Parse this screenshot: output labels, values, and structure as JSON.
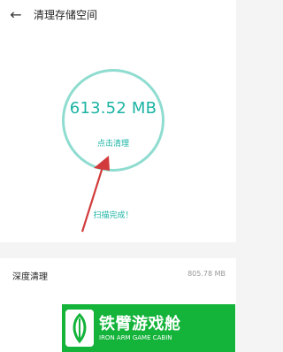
{
  "header": {
    "back_icon": "arrow-left-icon",
    "title": "清理存储空间"
  },
  "scan": {
    "size_text": "613.52 MB",
    "clean_link": "点击清理",
    "status": "扫描完成！",
    "ring_color": "#8fdcd0",
    "accent_color": "#19b3a3"
  },
  "deep_clean": {
    "label": "深度清理",
    "value": "805.78 MB"
  },
  "watermark": {
    "title": "铁臂游戏舱",
    "subtitle": "IRON ARM GAME CABIN",
    "color": "#14b33a"
  }
}
